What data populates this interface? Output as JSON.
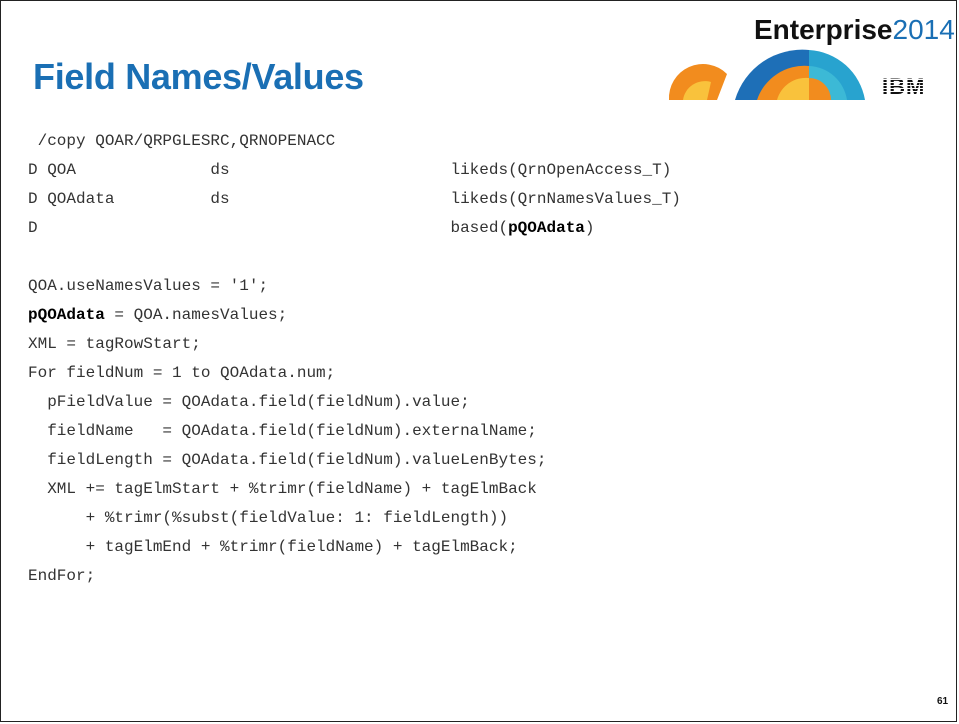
{
  "slide": {
    "title": "Field Names/Values",
    "brand": {
      "word": "Enterprise",
      "year": "2014"
    },
    "logo": "IBM",
    "page_number": "61"
  },
  "code": [
    {
      "segments": [
        {
          "t": " /copy QOAR/QRPGLESRC,QRNOPENACC"
        }
      ]
    },
    {
      "segments": [
        {
          "t": "D QOA              ds                       likeds(QrnOpenAccess_T)"
        }
      ]
    },
    {
      "segments": [
        {
          "t": "D QOAdata          ds                       likeds(QrnNamesValues_T)"
        }
      ]
    },
    {
      "segments": [
        {
          "t": "D                                           based("
        },
        {
          "t": "pQOAdata",
          "b": true
        },
        {
          "t": ")"
        }
      ]
    },
    {
      "segments": [
        {
          "t": ""
        }
      ]
    },
    {
      "segments": [
        {
          "t": "QOA.useNamesValues = '1';"
        }
      ]
    },
    {
      "segments": [
        {
          "t": "pQOAdata",
          "b": true
        },
        {
          "t": " = QOA.namesValues;"
        }
      ]
    },
    {
      "segments": [
        {
          "t": "XML = tagRowStart;"
        }
      ]
    },
    {
      "segments": [
        {
          "t": "For fieldNum = 1 to QOAdata.num;"
        }
      ]
    },
    {
      "segments": [
        {
          "t": "  pFieldValue = QOAdata.field(fieldNum).value;"
        }
      ]
    },
    {
      "segments": [
        {
          "t": "  fieldName   = QOAdata.field(fieldNum).externalName;"
        }
      ]
    },
    {
      "segments": [
        {
          "t": "  fieldLength = QOAdata.field(fieldNum).valueLenBytes;"
        }
      ]
    },
    {
      "segments": [
        {
          "t": "  XML += tagElmStart + %trimr(fieldName) + tagElmBack"
        }
      ]
    },
    {
      "segments": [
        {
          "t": "      + %trimr(%subst(fieldValue: 1: fieldLength))"
        }
      ]
    },
    {
      "segments": [
        {
          "t": "      + tagElmEnd + %trimr(fieldName) + tagElmBack;"
        }
      ]
    },
    {
      "segments": [
        {
          "t": "EndFor;"
        }
      ]
    }
  ],
  "colors": {
    "title": "#1a6fb4",
    "code": "#333333"
  }
}
